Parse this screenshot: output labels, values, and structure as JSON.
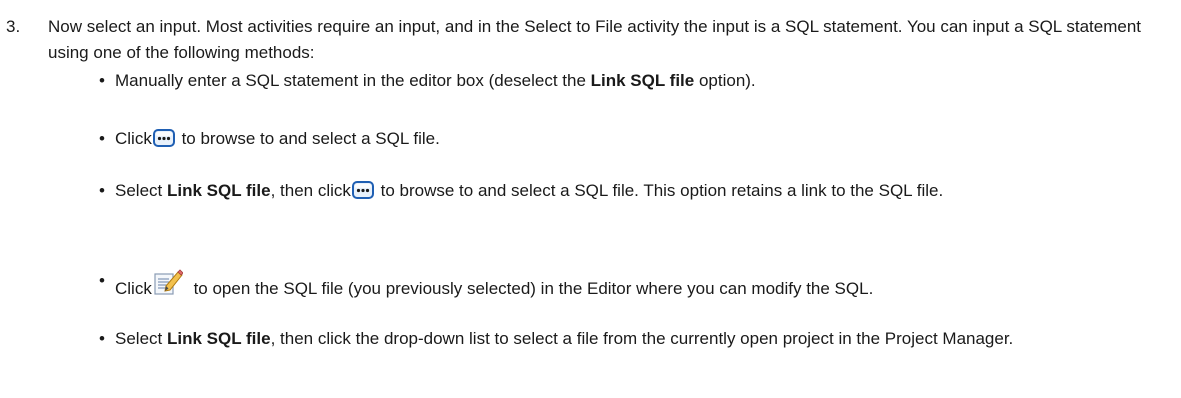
{
  "step": {
    "number": "3.",
    "text": "Now select an input. Most activities require an input, and in the Select to File activity the input is a SQL statement. You can input a SQL statement using one of the following methods:"
  },
  "bullets": [
    {
      "text_before": "Manually enter a SQL statement in the editor box (deselect the ",
      "bold": "Link SQL file",
      "text_after": " option)."
    },
    {
      "prefix": "Click",
      "icon": "browse-ellipsis-icon",
      "text_after": " to browse to and select a SQL file."
    },
    {
      "prefix": "Select ",
      "bold": "Link SQL file",
      "middle": ", then click",
      "icon": "browse-ellipsis-icon",
      "text_after": " to browse to and select a SQL file. This option retains a link to the SQL file."
    },
    {
      "prefix": "Click",
      "icon": "edit-document-icon",
      "text_after": " to open the SQL file (you previously selected) in the Editor where you can modify the SQL."
    },
    {
      "prefix": "Select ",
      "bold": "Link SQL file",
      "text_after": ", then click the drop-down list to select a file from the currently open project in the Project Manager."
    }
  ],
  "colors": {
    "text": "#1a1a1a",
    "browse_icon_border": "#1f5fb3",
    "browse_icon_fill": "#e8f1fb"
  }
}
